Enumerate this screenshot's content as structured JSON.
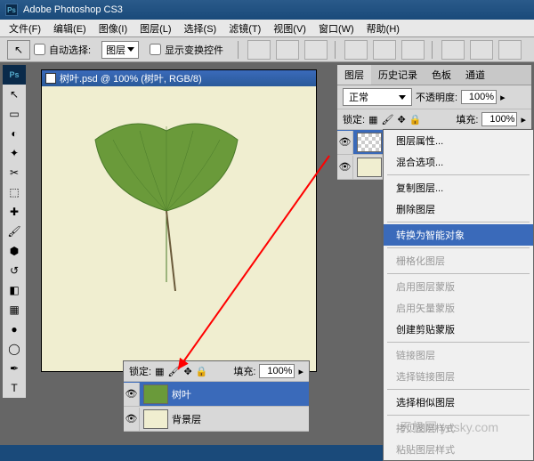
{
  "app": {
    "title": "Adobe Photoshop CS3"
  },
  "menu": [
    "文件(F)",
    "编辑(E)",
    "图像(I)",
    "图层(L)",
    "选择(S)",
    "滤镜(T)",
    "视图(V)",
    "窗口(W)",
    "帮助(H)"
  ],
  "options": {
    "auto_select": "自动选择:",
    "target": "图层",
    "show_transform": "显示变换控件"
  },
  "doc": {
    "title": "树叶.psd @ 100% (树叶, RGB/8)"
  },
  "panel": {
    "tabs": [
      "图层",
      "历史记录",
      "色板",
      "通道"
    ],
    "blend": "正常",
    "opacity_label": "不透明度:",
    "opacity": "100%",
    "lock_label": "锁定:",
    "fill_label": "填充:",
    "fill": "100%"
  },
  "layers": [
    {
      "name": "树叶",
      "selected": true,
      "thumb": "checker"
    },
    {
      "name": "背",
      "selected": false,
      "thumb": "bg"
    }
  ],
  "float_layers": [
    {
      "name": "树叶",
      "selected": true,
      "thumb": "leaf"
    },
    {
      "name": "背景层",
      "selected": false,
      "thumb": "bg"
    }
  ],
  "float": {
    "lock_label": "锁定:",
    "fill_label": "填充:",
    "fill": "100%"
  },
  "ctx": [
    {
      "t": "图层属性...",
      "type": "item"
    },
    {
      "t": "混合选项...",
      "type": "item"
    },
    {
      "type": "sep"
    },
    {
      "t": "复制图层...",
      "type": "item"
    },
    {
      "t": "删除图层",
      "type": "item"
    },
    {
      "type": "sep"
    },
    {
      "t": "转换为智能对象",
      "type": "hl"
    },
    {
      "type": "sep"
    },
    {
      "t": "栅格化图层",
      "type": "dis"
    },
    {
      "type": "sep"
    },
    {
      "t": "启用图层蒙版",
      "type": "dis"
    },
    {
      "t": "启用矢量蒙版",
      "type": "dis"
    },
    {
      "t": "创建剪贴蒙版",
      "type": "item"
    },
    {
      "type": "sep"
    },
    {
      "t": "链接图层",
      "type": "dis"
    },
    {
      "t": "选择链接图层",
      "type": "dis"
    },
    {
      "type": "sep"
    },
    {
      "t": "选择相似图层",
      "type": "item"
    },
    {
      "type": "sep"
    },
    {
      "t": "拷贝图层样式",
      "type": "dis"
    },
    {
      "t": "粘贴图层样式",
      "type": "dis"
    }
  ],
  "watermark": "天极网 yesky.com"
}
